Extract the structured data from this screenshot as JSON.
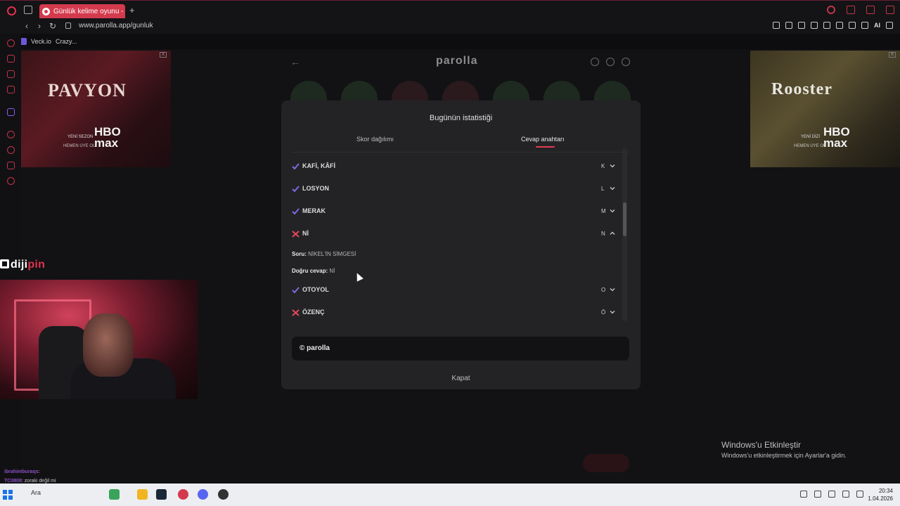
{
  "browser": {
    "tab_title": "Günlük kelime oyunu - par",
    "new_tab": "+",
    "url": "www.parolla.app/gunluk",
    "ai_label": "AI",
    "bookmarks": [
      "Veck.io",
      "Crazy..."
    ]
  },
  "ads": {
    "left": {
      "title": "PAVYON",
      "sub": "YENİ SEZON",
      "brand_line1": "HBO",
      "brand_line2": "max",
      "cta": "HEMEN ÜYE OL",
      "tag": "X"
    },
    "right": {
      "title": "Rooster",
      "sub": "YENİ DİZİ",
      "brand_line1": "HBO",
      "brand_line2": "max",
      "cta": "HEMEN ÜYE OL",
      "tag": "X"
    }
  },
  "game": {
    "back": "←",
    "title": "parolla"
  },
  "modal": {
    "title": "Bugünün istatistiği",
    "tabs": [
      {
        "label": "Skor dağılımı",
        "active": false
      },
      {
        "label": "Cevap anahtarı",
        "active": true
      }
    ],
    "rows": [
      {
        "word": "KAFİ, KÂFİ",
        "letter": "K",
        "correct": true,
        "expanded": false
      },
      {
        "word": "LOSYON",
        "letter": "L",
        "correct": true,
        "expanded": false
      },
      {
        "word": "MERAK",
        "letter": "M",
        "correct": true,
        "expanded": false
      },
      {
        "word": "Nİ",
        "letter": "N",
        "correct": false,
        "expanded": true
      },
      {
        "word": "OTOYOL",
        "letter": "O",
        "correct": true,
        "expanded": false
      },
      {
        "word": "ÖZENÇ",
        "letter": "Ö",
        "correct": false,
        "expanded": false
      }
    ],
    "detail": {
      "question_label": "Soru:",
      "question": "NİKEL'İN SİMGESİ",
      "answer_label": "Doğru cevap:",
      "answer": "Nİ"
    },
    "share_text": "© parolla",
    "close_label": "Kapat",
    "accent_color": "#e53c52",
    "correct_color": "#7a6de0",
    "wrong_color": "#e5485d"
  },
  "stream": {
    "brand_a": "diji",
    "brand_b": "pin",
    "chat": [
      {
        "user": "ibrahimburaqs",
        "text": ":"
      },
      {
        "user": "TC0808",
        "text": ": zoraki değil mi"
      }
    ]
  },
  "activation": {
    "line1": "Windows'u Etkinleştir",
    "line2": "Windows'u etkinleştirmek için Ayarlar'a gidin."
  },
  "taskbar": {
    "search": "Ara",
    "time": "20:34",
    "date": "1.04.2026"
  }
}
